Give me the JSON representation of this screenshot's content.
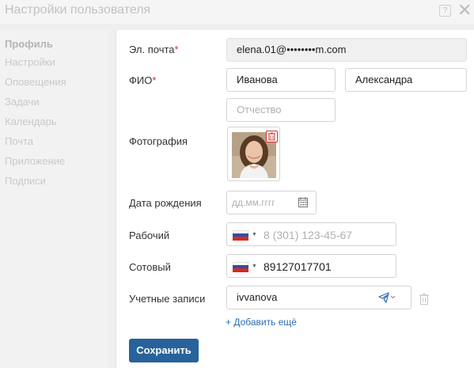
{
  "window": {
    "title": "Настройки пользователя",
    "help_label": "?",
    "close_label": "✕"
  },
  "sidebar": {
    "items": [
      {
        "label": "Профиль",
        "active": true
      },
      {
        "label": "Настройки"
      },
      {
        "label": "Оповещения"
      },
      {
        "label": "Задачи"
      },
      {
        "label": "Календарь"
      },
      {
        "label": "Почта"
      },
      {
        "label": "Приложение"
      },
      {
        "label": "Подписи"
      }
    ]
  },
  "form": {
    "email": {
      "label": "Эл. почта",
      "required_mark": "*",
      "value": "elena.01@••••••••m.com"
    },
    "fio": {
      "label": "ФИО",
      "required_mark": "*",
      "last_name": "Иванова",
      "first_name": "Александра",
      "middle_placeholder": "Отчество"
    },
    "photo": {
      "label": "Фотография"
    },
    "birthdate": {
      "label": "Дата рождения",
      "placeholder": "дд.мм.гггг"
    },
    "work_phone": {
      "label": "Рабочий",
      "placeholder": "8 (301) 123-45-67",
      "country": "RU"
    },
    "mobile_phone": {
      "label": "Сотовый",
      "value": "89127017701",
      "country": "RU"
    },
    "accounts": {
      "label": "Учетные записи",
      "value": "ivvanova",
      "channel_icon": "telegram-icon",
      "add_label": "+ Добавить ещё"
    },
    "save_label": "Сохранить"
  },
  "colors": {
    "accent": "#27629b",
    "link": "#2d6db0",
    "required": "#d0312d"
  }
}
